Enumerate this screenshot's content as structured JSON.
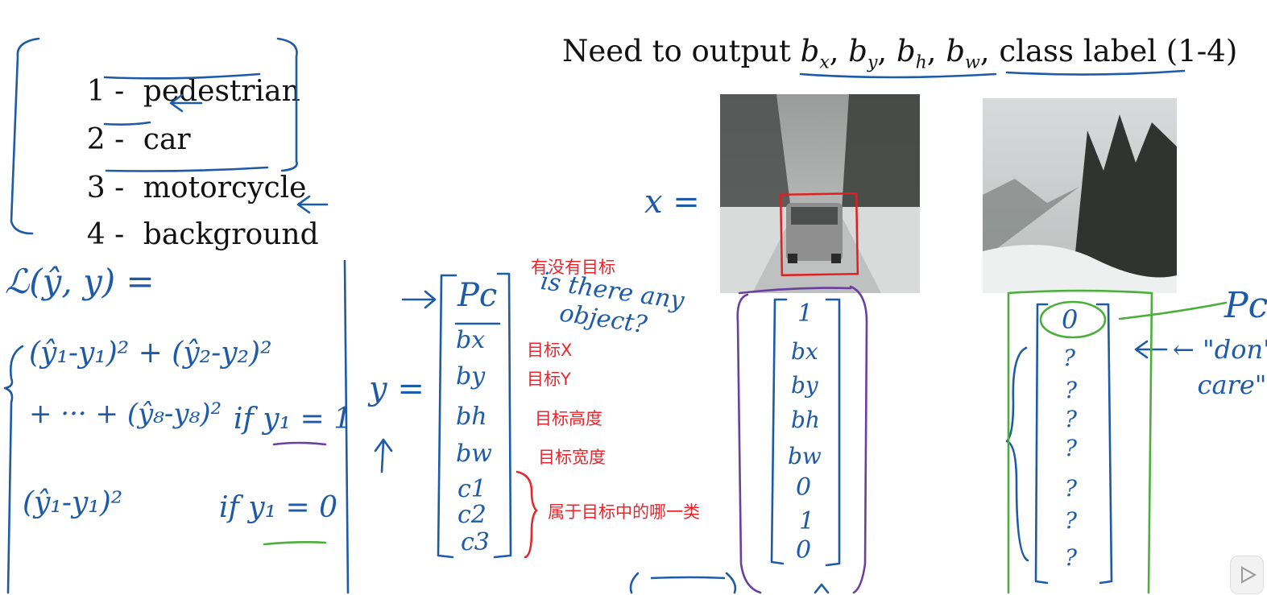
{
  "class_list": [
    {
      "number": "1 -",
      "label": "pedestrian"
    },
    {
      "number": "2 -",
      "label": "car"
    },
    {
      "number": "3 -",
      "label": "motorcycle"
    },
    {
      "number": "4 -",
      "label": "background"
    }
  ],
  "title": {
    "prefix": "Need to output ",
    "bx": "b",
    "bx_sub": "x",
    "by": "b",
    "by_sub": "y",
    "bh": "b",
    "bh_sub": "h",
    "bw": "b",
    "bw_sub": "w",
    "sep": ", ",
    "suffix": "class label (1-4)"
  },
  "handwriting": {
    "x_equals": "x =",
    "y_equals": "y =",
    "loss": "ℒ(ŷ, y) =",
    "loss_case1_line1": "(ŷ₁-y₁)² + (ŷ₂-y₂)²",
    "loss_case1_line2": "+ ··· + (ŷ₈-y₈)²",
    "if_y1_eq_1": "if y₁ = 1",
    "loss_case2": "(ŷ₁-y₁)²",
    "if_y1_eq_0": "if y₁ = 0",
    "is_there_any_object": "is there any\n   object?",
    "pc_label": "Pc",
    "dont_care": "← \"don't\n   care\"",
    "y_vector": [
      "Pc",
      "bx",
      "by",
      "bh",
      "bw",
      "c1",
      "c2",
      "c3"
    ],
    "car_vector": [
      "1",
      "bx",
      "by",
      "bh",
      "bw",
      "0",
      "1",
      "0"
    ],
    "bg_vector": [
      "0",
      "?",
      "?",
      "?",
      "?",
      "?",
      "?",
      "?"
    ]
  },
  "annotations_cn": {
    "has_object": "有没有目标",
    "target_x": "目标X",
    "target_y": "目标Y",
    "target_height": "目标高度",
    "target_width": "目标宽度",
    "which_class": "属于目标中的哪一类"
  },
  "images": {
    "car_photo": "snowy road with car",
    "background_photo": "snowy road forest"
  },
  "colors": {
    "ink_blue": "#1d5aa8",
    "ink_purple": "#6a3fa0",
    "ink_green": "#4caf3c",
    "ink_red": "#e8262d",
    "box_red": "#e02020"
  }
}
